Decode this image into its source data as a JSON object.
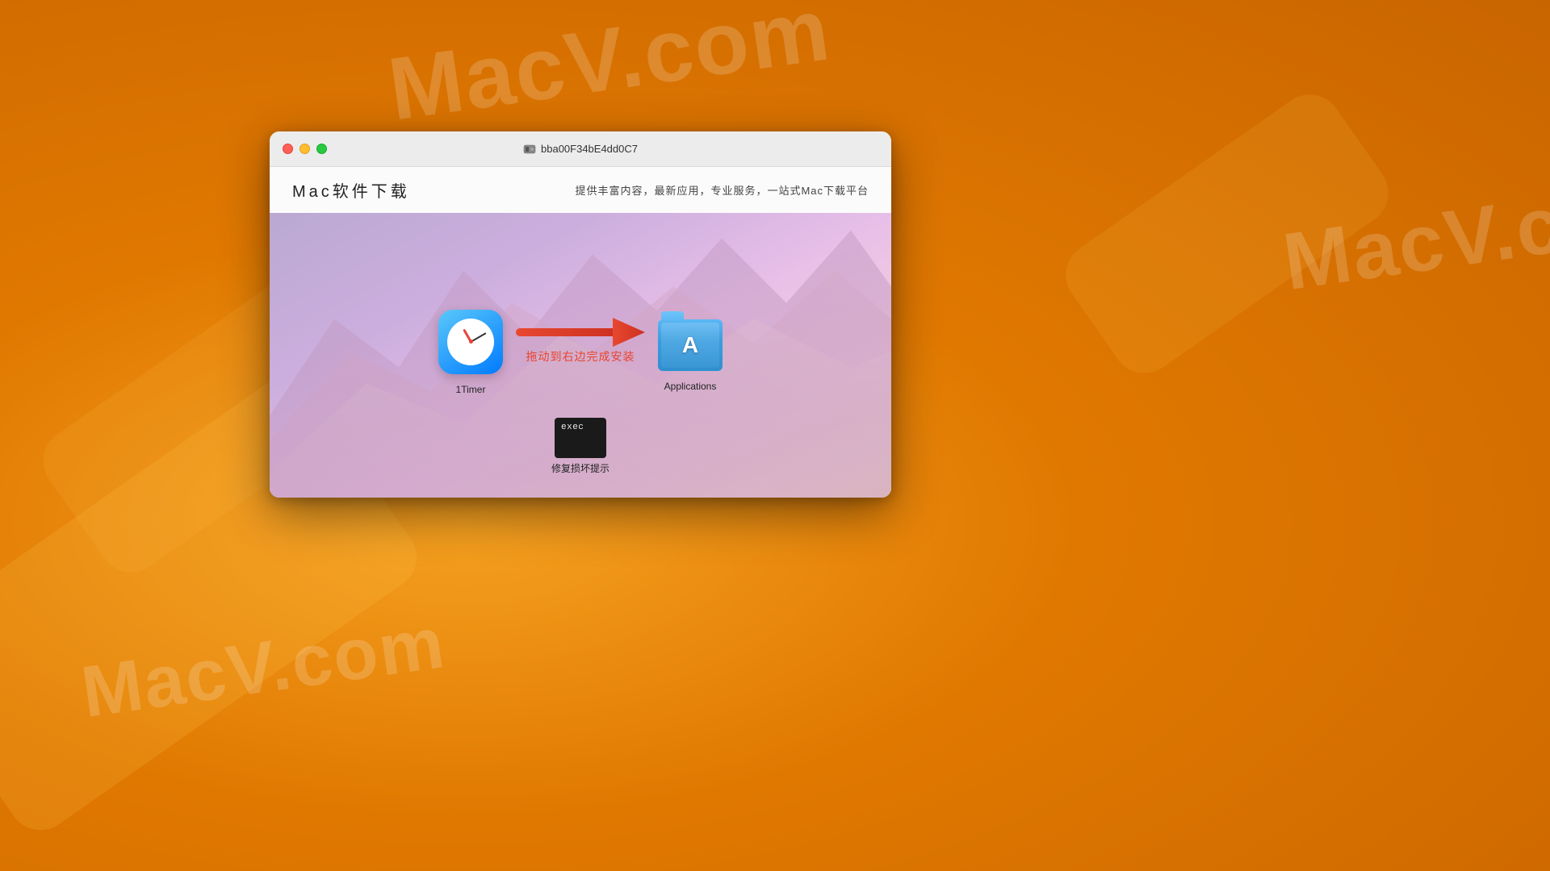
{
  "background": {
    "color": "#E07800"
  },
  "watermarks": [
    {
      "text": "MacV.com",
      "position": "top-center"
    },
    {
      "text": "MacV.co",
      "position": "right"
    },
    {
      "text": "MacV.com",
      "position": "bottom-left"
    }
  ],
  "window": {
    "title": "bba00F34bE4dd0C7",
    "traffic_lights": {
      "close_color": "#FF5F57",
      "minimize_color": "#FFBD2E",
      "maximize_color": "#28C941"
    },
    "header": {
      "site_title": "Mac软件下载",
      "site_tagline": "提供丰富内容，最新应用，专业服务，一站式Mac下载平台"
    },
    "dmg": {
      "app_icon_label": "1Timer",
      "arrow_direction": "right",
      "drag_instruction": "拖动到右边完成安装",
      "folder_label": "Applications",
      "exec_label": "修复损坏提示",
      "exec_text": "exec"
    }
  }
}
